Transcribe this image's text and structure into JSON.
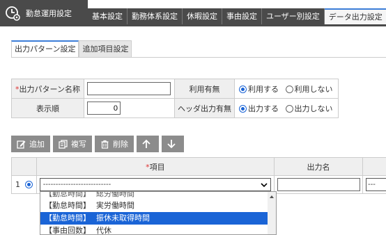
{
  "app": {
    "title": "勤怠運用設定"
  },
  "top_tabs": [
    {
      "label": "基本設定",
      "active": false
    },
    {
      "label": "勤務体系設定",
      "active": false
    },
    {
      "label": "休暇設定",
      "active": false
    },
    {
      "label": "事由設定",
      "active": false
    },
    {
      "label": "ユーザー別設定",
      "active": false
    },
    {
      "label": "データ出力設定",
      "active": true
    }
  ],
  "sub_tabs": [
    {
      "label": "出力パターン設定",
      "active": true
    },
    {
      "label": "追加項目設定",
      "active": false
    }
  ],
  "form": {
    "pattern_name": {
      "required_mark": "*",
      "label": "出力パターン名称",
      "value": ""
    },
    "usage": {
      "label": "利用有無",
      "options": [
        "利用する",
        "利用しない"
      ],
      "selected": 0
    },
    "display_order": {
      "label": "表示順",
      "value": "0"
    },
    "header_output": {
      "label": "ヘッダ出力有無",
      "options": [
        "出力する",
        "出力しない"
      ],
      "selected": 0
    }
  },
  "toolbar": {
    "add_label": "追加",
    "copy_label": "複写",
    "delete_label": "削除",
    "up_icon": "arrow-up-icon",
    "down_icon": "arrow-down-icon"
  },
  "grid": {
    "headers": {
      "item_required_mark": "*",
      "item": "項目",
      "output_name": "出力名"
    },
    "rows": [
      {
        "number": "1",
        "item_value": "---------------------------",
        "output_name": "",
        "extra_value": "---"
      }
    ]
  },
  "dropdown": {
    "options": [
      {
        "category": "【勤怠時間】",
        "name": "総労働時間",
        "state": "cut"
      },
      {
        "category": "【勤怠時間】",
        "name": "実労働時間",
        "state": "normal"
      },
      {
        "category": "【勤怠時間】",
        "name": "振休未取得時間",
        "state": "selected"
      },
      {
        "category": "【事由回数】",
        "name": "代休",
        "state": "normal"
      }
    ]
  },
  "colors": {
    "header_bg": "#4a4a4a",
    "accent": "#3b7dd8",
    "selected": "#1a64d6",
    "button": "#8c8c8c"
  }
}
